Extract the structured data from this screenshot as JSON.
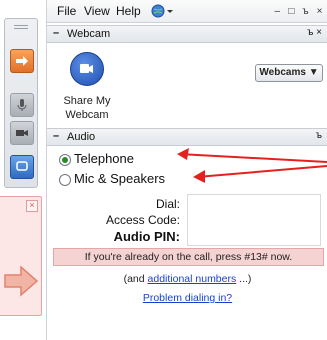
{
  "menu": {
    "file": "File",
    "view": "View",
    "help": "Help"
  },
  "webcam": {
    "title": "Webcam",
    "share_label_line1": "Share My",
    "share_label_line2": "Webcam",
    "webcams_label": "Webcams ▼"
  },
  "audio": {
    "title": "Audio",
    "options": [
      {
        "label": "Telephone",
        "selected": true
      },
      {
        "label": "Mic & Speakers",
        "selected": false
      }
    ],
    "dial_label": "Dial:",
    "access_code_label": "Access Code:",
    "audio_pin_label": "Audio PIN:",
    "notice": "If you're already on the call, press #13# now.",
    "additional_prefix": "(and ",
    "additional_link": "additional numbers",
    "additional_suffix": " ...)",
    "problem_link": "Problem dialing in?"
  },
  "colors": {
    "arrow": "#e5211f",
    "notice_bg": "#f6d3d3",
    "link": "#1a3fd0"
  }
}
